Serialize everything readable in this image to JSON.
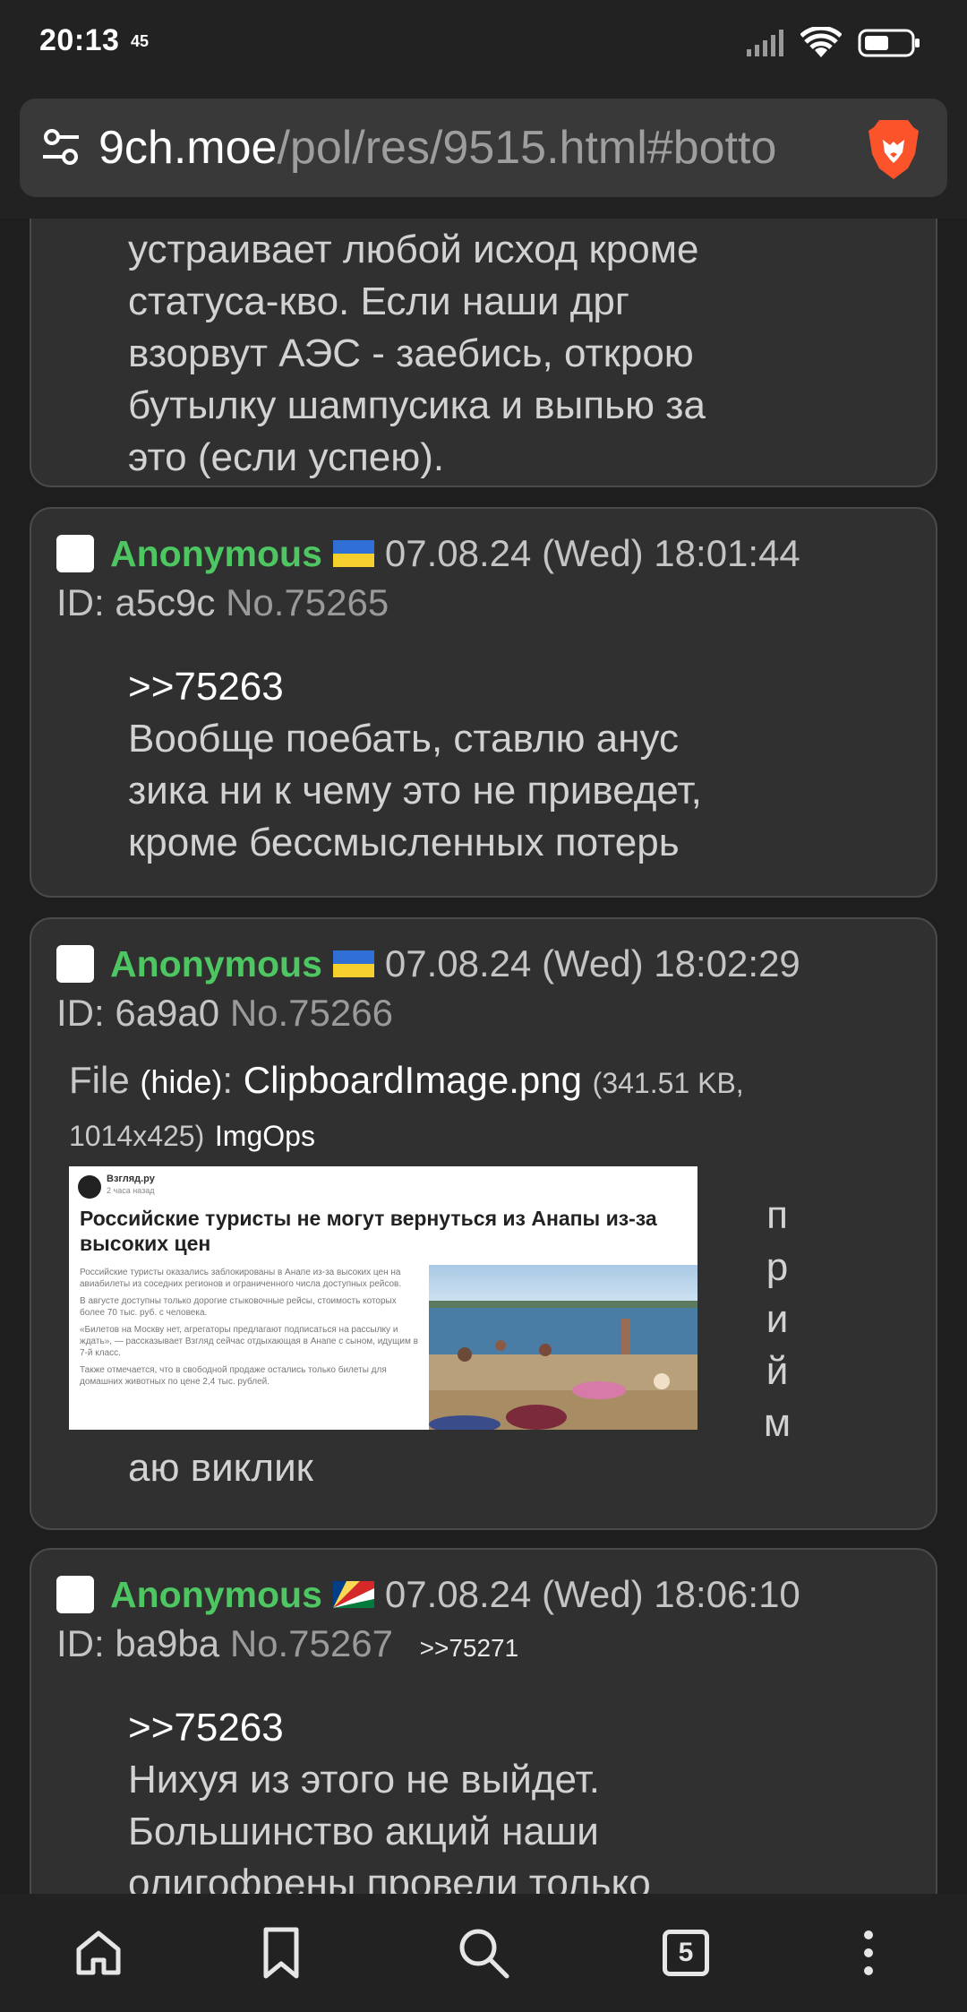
{
  "status_bar": {
    "time": "20:13",
    "sub": "45",
    "icons": [
      "signal-icon",
      "wifi-icon",
      "battery-icon"
    ]
  },
  "browser": {
    "url_host": "9ch.moe",
    "url_path": "/pol/res/9515.html#botto",
    "tabs_count": "5"
  },
  "posts": [
    {
      "partial": true,
      "lines": [
        "устраивает любой исход кроме",
        "статуса-кво. Если наши дрг",
        "взорвут АЭС - заебись, открою",
        "бутылку шампусика и выпью за",
        "это (если успею)."
      ]
    },
    {
      "name": "Anonymous",
      "flag": "ukraine",
      "date": "07.08.24 (Wed) 18:01:44",
      "id": "ID: a5c9c",
      "no": "No.75265",
      "quote": ">>75263",
      "lines": [
        "Вообще поебать, ставлю анус",
        "зика ни к чему это не приведет,",
        "кроме бессмысленных потерь"
      ]
    },
    {
      "name": "Anonymous",
      "flag": "ukraine",
      "date": "07.08.24 (Wed) 18:02:29",
      "id": "ID: 6a9a0",
      "no": "No.75266",
      "file": {
        "label": "File",
        "hide": "(hide)",
        "colon": ":",
        "name": "ClipboardImage.png",
        "meta_a": "(341.51 KB,",
        "meta_b": "1014x425)",
        "imgops": "ImgOps"
      },
      "thumb": {
        "source": "Взгляд.ру",
        "time": "2 часа назад",
        "headline": "Российские туристы не могут вернуться из Анапы из-за высоких цен",
        "p1": "Российские туристы оказались заблокированы в Анапе из-за высоких цен на авиабилеты из соседних регионов и ограниченного числа доступных рейсов.",
        "p2": "В августе доступны только дорогие стыковочные рейсы, стоимость которых более 70 тыс. руб. с человека.",
        "p3": "«Билетов на Москву нет, агрегаторы предлагают подписаться на рассылку и ждать», — рассказывает Взгляд сейчас отдыхающая в Анапе с сыном, идущим в 7-й класс.",
        "p4": "Также отмечается, что в свободной продаже остались только билеты для домашних животных по цене 2,4 тыс. рублей."
      },
      "vertical": [
        "п",
        "р",
        "и",
        "й",
        "м"
      ],
      "tail": "аю виклик"
    },
    {
      "name": "Anonymous",
      "flag": "seychelles",
      "date": "07.08.24 (Wed) 18:06:10",
      "id": "ID: ba9ba",
      "no": "No.75267",
      "backlink": ">>75271",
      "quote": ">>75263",
      "lines": [
        "Нихуя из этого не выйдет.",
        "Большинство акций наши",
        "олигофрены провели только"
      ]
    }
  ],
  "bottom_nav": [
    "home-icon",
    "bookmark-icon",
    "search-icon",
    "tabs-icon",
    "menu-icon"
  ]
}
